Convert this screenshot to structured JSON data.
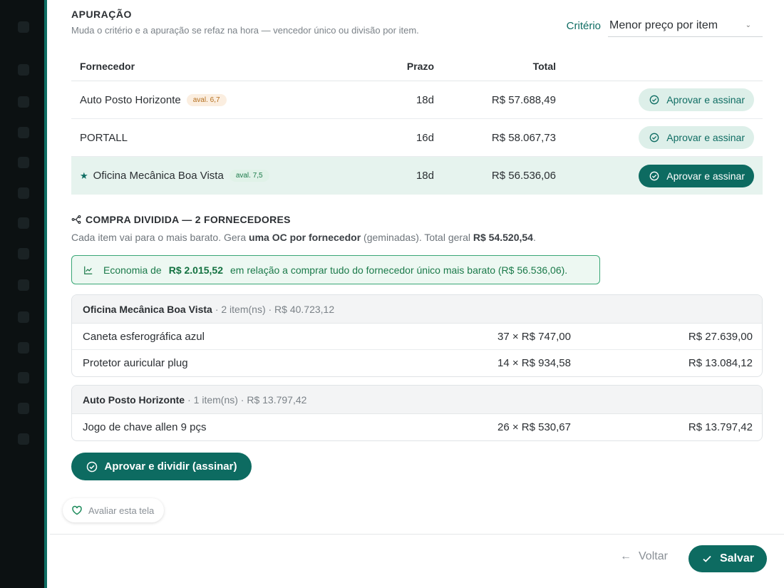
{
  "header": {
    "title": "APURAÇÃO",
    "subtitle": "Muda o critério e a apuração se refaz na hora — vencedor único ou divisão por item.",
    "criterion_label": "Critério",
    "criterion_value": "Menor preço por item"
  },
  "table": {
    "headers": {
      "supplier": "Fornecedor",
      "term": "Prazo",
      "total": "Total"
    },
    "rows": [
      {
        "star": "",
        "name": "Auto Posto Horizonte",
        "rating": "aval. 6,7",
        "term": "18d",
        "total": "R$ 57.688,49",
        "action": "Aprovar e assinar"
      },
      {
        "star": "",
        "name": "PORTALL",
        "rating": "",
        "term": "16d",
        "total": "R$ 58.067,73",
        "action": "Aprovar e assinar"
      },
      {
        "star": "★",
        "name": "Oficina Mecânica Boa Vista",
        "rating": "aval. 7,5",
        "term": "18d",
        "total": "R$ 56.536,06",
        "action": "Aprovar e assinar"
      }
    ]
  },
  "split": {
    "title": "COMPRA DIVIDIDA — 2 FORNECEDORES",
    "sub_a": "Cada item vai para o mais barato. Gera ",
    "sub_b": "uma OC por fornecedor",
    "sub_c": " (geminadas). Total geral ",
    "sub_total": "R$ 54.520,54",
    "sub_end": ".",
    "savings_a": "Economia de",
    "savings_value": "R$ 2.015,52",
    "savings_b": "em relação a comprar tudo do fornecedor único mais barato (R$ 56.536,06).",
    "groups": [
      {
        "name": "Oficina Mecânica Boa Vista",
        "meta": "· 2 item(ns) · R$ 40.723,12",
        "items": [
          {
            "name": "Caneta esferográfica azul",
            "qty": "37 × R$ 747,00",
            "sum": "R$ 27.639,00"
          },
          {
            "name": "Protetor auricular plug",
            "qty": "14 × R$ 934,58",
            "sum": "R$ 13.084,12"
          }
        ]
      },
      {
        "name": "Auto Posto Horizonte",
        "meta": "· 1 item(ns) · R$ 13.797,42",
        "items": [
          {
            "name": "Jogo de chave allen 9 pçs",
            "qty": "26 × R$ 530,67",
            "sum": "R$ 13.797,42"
          }
        ]
      }
    ],
    "approve_split": "Aprovar e dividir (assinar)"
  },
  "feedback": {
    "label": "Avaliar esta tela"
  },
  "footer": {
    "back": "Voltar",
    "save": "Salvar"
  },
  "colors": {
    "brand": "#0d6b61",
    "win_row": "#e6f3ee",
    "savings_border": "#39a776"
  }
}
